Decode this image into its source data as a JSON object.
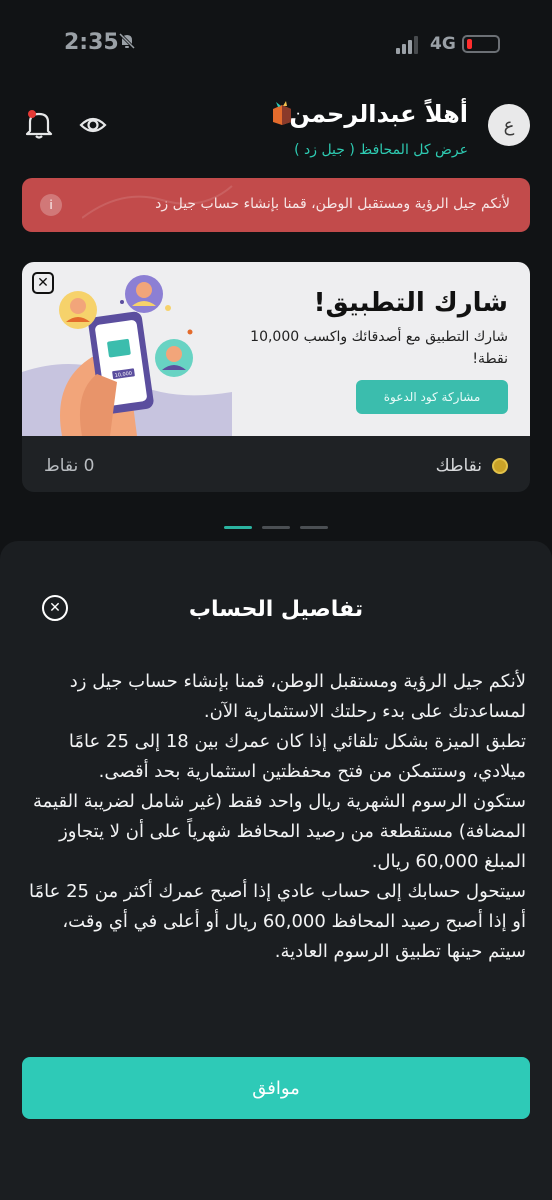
{
  "status_bar": {
    "time": "2:35",
    "network": "4G",
    "battery_level": 0.1,
    "battery_color": "#ff2d2d",
    "icons": [
      "bell-slash-icon",
      "signal-icon",
      "battery-icon"
    ]
  },
  "header": {
    "avatar_initial": "ع",
    "greeting": "أهلاً عبدالرحمن",
    "portfolio_link": "عرض كل المحافظ ( جيل زد )",
    "icons": [
      "gift-icon",
      "eye-icon",
      "bell-icon"
    ]
  },
  "alert": {
    "text": "لأنكم جيل الرؤية ومستقبل الوطن، قمنا بإنشاء حساب جيل زد",
    "icon": "info-icon",
    "color": "#c24b4b"
  },
  "share_card": {
    "title": "شارك التطبيق!",
    "description": "شارك التطبيق مع أصدقائك واكسب 10,000 نقطة!",
    "button_label": "مشاركة كود الدعوة",
    "points_label": "نقاطك",
    "points_value": "0 نقاط",
    "phone_amount": "10,000",
    "accent": "#3bbdad"
  },
  "pager": {
    "count": 3,
    "active_index": 0
  },
  "sheet": {
    "title": "تفاصيل الحساب",
    "paragraphs": [
      "لأنكم جيل الرؤية ومستقبل الوطن، قمنا بإنشاء حساب جيل زد لمساعدتك على بدء رحلتك الاستثمارية الآن.",
      " تطبق الميزة بشكل تلقائي إذا كان عمرك بين 18 إلى 25 عامًا ميلادي، وستتمكن من فتح محفظتين استثمارية بحد أقصى.",
      "ستكون الرسوم الشهرية ريال واحد فقط (غير شامل لضريبة القيمة المضافة) مستقطعة من رصيد المحافظ شهرياً على أن لا يتجاوز المبلغ 60,000 ريال.",
      "سيتحول حسابك إلى حساب عادي إذا أصبح عمرك أكثر من 25 عامًا أو إذا أصبح رصيد المحافظ 60,000 ريال أو أعلى في أي وقت، سيتم حينها تطبيق الرسوم العادية."
    ],
    "confirm_label": "موافق",
    "confirm_color": "#2ecab7"
  }
}
